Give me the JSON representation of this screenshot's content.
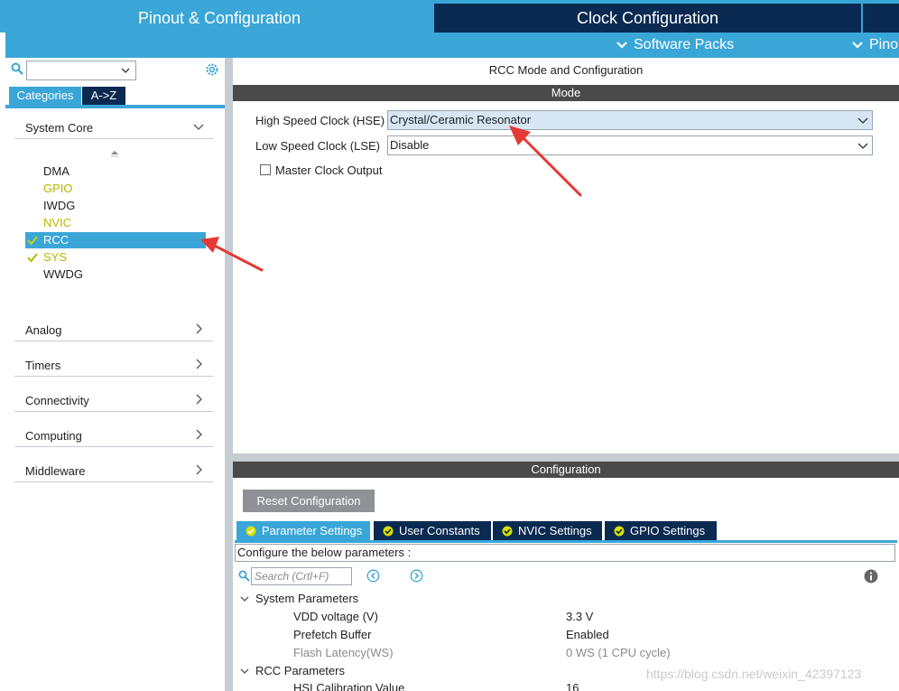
{
  "top_tabs": {
    "pinout": "Pinout & Configuration",
    "clock": "Clock Configuration"
  },
  "sub_bar": {
    "software_packs": "Software Packs",
    "pinout": "Pino"
  },
  "left": {
    "search_value": "",
    "categories_label": "Categories",
    "az_label": "A->Z",
    "system_core": "System Core",
    "peripherals": [
      {
        "name": "DMA",
        "state": "normal"
      },
      {
        "name": "GPIO",
        "state": "warn"
      },
      {
        "name": "IWDG",
        "state": "normal"
      },
      {
        "name": "NVIC",
        "state": "warn"
      },
      {
        "name": "RCC",
        "state": "selected-checked"
      },
      {
        "name": "SYS",
        "state": "checked"
      },
      {
        "name": "WWDG",
        "state": "normal"
      }
    ],
    "groups": [
      "Analog",
      "Timers",
      "Connectivity",
      "Computing",
      "Middleware"
    ]
  },
  "mode": {
    "title": "RCC Mode and Configuration",
    "bar": "Mode",
    "hse_label": "High Speed Clock (HSE)",
    "hse_value": "Crystal/Ceramic Resonator",
    "lse_label": "Low Speed Clock (LSE)",
    "lse_value": "Disable",
    "mco_label": "Master Clock Output",
    "mco_checked": false
  },
  "config": {
    "bar": "Configuration",
    "reset_label": "Reset Configuration",
    "tabs": [
      "Parameter Settings",
      "User Constants",
      "NVIC Settings",
      "GPIO Settings"
    ],
    "description": "Configure the below parameters :",
    "search_placeholder": "Search (Crtl+F)",
    "sections": [
      {
        "name": "System Parameters",
        "params": [
          {
            "name": "VDD voltage (V)",
            "value": "3.3 V",
            "dim": false
          },
          {
            "name": "Prefetch Buffer",
            "value": "Enabled",
            "dim": false
          },
          {
            "name": "Flash Latency(WS)",
            "value": "0 WS (1 CPU cycle)",
            "dim": true
          }
        ]
      },
      {
        "name": "RCC Parameters",
        "params": [
          {
            "name": "HSI Calibration Value",
            "value": "16",
            "dim": false
          }
        ]
      }
    ]
  },
  "watermark": "https://blog.csdn.net/weixin_42397123",
  "colors": {
    "accent": "#3aa6d8",
    "navy": "#0b2a52",
    "warn": "#b7b700",
    "arrow": "#e53935"
  }
}
